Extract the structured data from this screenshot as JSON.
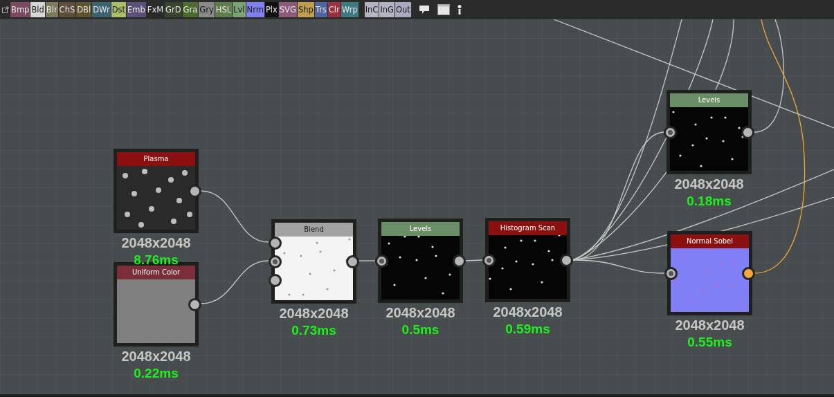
{
  "toolbar": {
    "node_buttons": [
      {
        "label": "Bmp",
        "color": "#7a4a5e"
      },
      {
        "label": "Bld",
        "color": "#d6d6d6"
      },
      {
        "label": "Blr",
        "color": "#7d7a5e"
      },
      {
        "label": "ChS",
        "color": "#5c4d3a"
      },
      {
        "label": "DBl",
        "color": "#5e5430"
      },
      {
        "label": "DWr",
        "color": "#3c6470"
      },
      {
        "label": "Dst",
        "color": "#a9c068"
      },
      {
        "label": "Emb",
        "color": "#5c5078"
      },
      {
        "label": "FxM",
        "color": "#2a2a2a"
      },
      {
        "label": "GrD",
        "color": "#37452e"
      },
      {
        "label": "Gra",
        "color": "#4b6b2f"
      },
      {
        "label": "Gry",
        "color": "#8a8a8a"
      },
      {
        "label": "HSL",
        "color": "#5f7e4c"
      },
      {
        "label": "Lvl",
        "color": "#7da276"
      },
      {
        "label": "Nrm",
        "color": "#8080f0"
      },
      {
        "label": "Plx",
        "color": "#111111"
      },
      {
        "label": "SVG",
        "color": "#8d5a7a"
      },
      {
        "label": "Shp",
        "color": "#c0a050"
      },
      {
        "label": "Trs",
        "color": "#5064a0"
      },
      {
        "label": "Clr",
        "color": "#9a3040"
      },
      {
        "label": "Wrp",
        "color": "#3c7a80"
      }
    ],
    "io_buttons": [
      {
        "label": "InC",
        "color": "#b4b4c4"
      },
      {
        "label": "InG",
        "color": "#b4b4c4"
      },
      {
        "label": "Out",
        "color": "#a8a8c0"
      }
    ]
  },
  "nodes": [
    {
      "title": "Plasma",
      "color": "#8b1010",
      "kind": "noise",
      "resolution": "2048x2048",
      "time": "8.76ms",
      "outputs": [
        {
          "kind": "ring",
          "color": "#b5b5b5"
        }
      ]
    },
    {
      "title": "Uniform Color",
      "color": "#7a2e38",
      "kind": "flat",
      "resolution": "2048x2048",
      "time": "0.22ms",
      "outputs": [
        {
          "kind": "ring",
          "color": "#b5b5b5"
        }
      ]
    },
    {
      "title": "Blend",
      "color": "#a3a3a3",
      "kind": "speckle",
      "resolution": "2048x2048",
      "time": "0.73ms",
      "inputs": [
        {
          "kind": "ring",
          "color": "#b5b5b5"
        },
        {
          "kind": "dot",
          "color": "#b5b5b5"
        },
        {
          "kind": "ring",
          "color": "#b5b5b5"
        }
      ],
      "outputs": [
        {
          "kind": "ring",
          "color": "#b5b5b5"
        }
      ]
    },
    {
      "title": "Levels",
      "color": "#6a8f66",
      "kind": "stars",
      "resolution": "2048x2048",
      "time": "0.5ms",
      "inputs": [
        {
          "kind": "dot",
          "color": "#b5b5b5"
        }
      ],
      "outputs": [
        {
          "kind": "ring",
          "color": "#b5b5b5"
        }
      ]
    },
    {
      "title": "Histogram Scan",
      "color": "#8b1010",
      "kind": "stars",
      "resolution": "2048x2048",
      "time": "0.59ms",
      "inputs": [
        {
          "kind": "dot",
          "color": "#b5b5b5"
        }
      ],
      "outputs": [
        {
          "kind": "ring",
          "color": "#b5b5b5"
        }
      ]
    },
    {
      "title": "Levels",
      "color": "#6a8f66",
      "kind": "stars",
      "resolution": "2048x2048",
      "time": "0.18ms",
      "inputs": [
        {
          "kind": "dot",
          "color": "#b5b5b5"
        }
      ],
      "outputs": [
        {
          "kind": "ring",
          "color": "#b5b5b5"
        }
      ]
    },
    {
      "title": "Normal Sobel",
      "color": "#8b1010",
      "kind": "normal",
      "resolution": "2048x2048",
      "time": "0.55ms",
      "inputs": [
        {
          "kind": "dot",
          "color": "#b5b5b5"
        }
      ],
      "outputs": [
        {
          "kind": "ring",
          "color": "#f5a742"
        }
      ]
    }
  ]
}
